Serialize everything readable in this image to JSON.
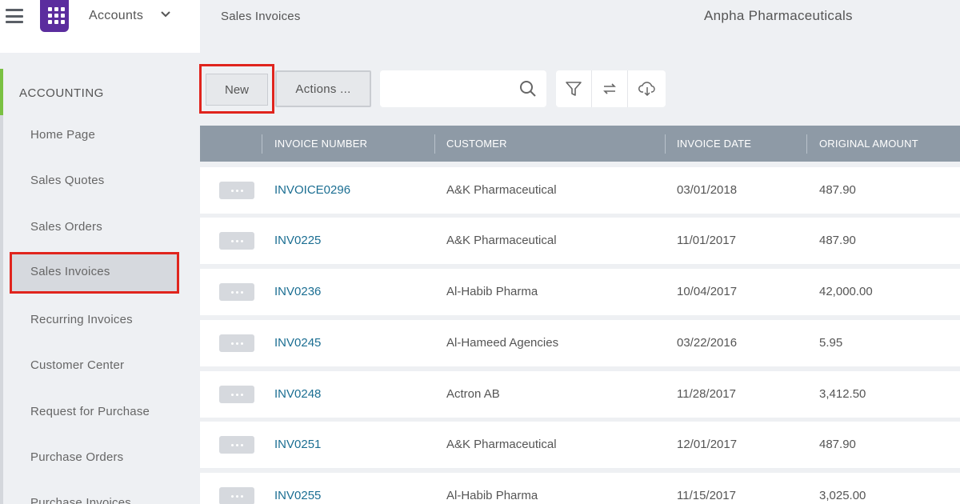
{
  "header": {
    "module": "Accounts",
    "breadcrumb": "Sales Invoices",
    "company": "Anpha Pharmaceuticals"
  },
  "icons": {
    "menu": "hamburger-menu-icon",
    "logo": "app-grid-logo",
    "module_toggle": "chevron-down-icon",
    "search": "search-icon",
    "filter": "filter-icon",
    "refresh": "refresh-icon",
    "download": "cloud-download-icon",
    "row_actions": "more-horizontal-icon"
  },
  "colors": {
    "accent_green": "#7ac142",
    "brand_purple": "#5b2d9e",
    "highlight_red": "#e0241d",
    "table_header": "#8e9aa6",
    "link": "#1b6e92"
  },
  "sidebar": {
    "section": "ACCOUNTING",
    "items": [
      {
        "label": "Home Page",
        "active": false
      },
      {
        "label": "Sales Quotes",
        "active": false
      },
      {
        "label": "Sales Orders",
        "active": false
      },
      {
        "label": "Sales Invoices",
        "active": true
      },
      {
        "label": "Recurring Invoices",
        "active": false
      },
      {
        "label": "Customer Center",
        "active": false
      },
      {
        "label": "Request for Purchase",
        "active": false
      },
      {
        "label": "Purchase Orders",
        "active": false
      },
      {
        "label": "Purchase Invoices",
        "active": false
      }
    ]
  },
  "toolbar": {
    "new_label": "New",
    "actions_label": "Actions ...",
    "search_value": "",
    "search_placeholder": ""
  },
  "table": {
    "columns": [
      "INVOICE NUMBER",
      "CUSTOMER",
      "INVOICE DATE",
      "ORIGINAL AMOUNT"
    ],
    "rows": [
      {
        "invoice_number": "INVOICE0296",
        "customer": "A&K Pharmaceutical",
        "invoice_date": "03/01/2018",
        "original_amount": "487.90"
      },
      {
        "invoice_number": "INV0225",
        "customer": "A&K Pharmaceutical",
        "invoice_date": "11/01/2017",
        "original_amount": "487.90"
      },
      {
        "invoice_number": "INV0236",
        "customer": "Al-Habib Pharma",
        "invoice_date": "10/04/2017",
        "original_amount": "42,000.00"
      },
      {
        "invoice_number": "INV0245",
        "customer": "Al-Hameed Agencies",
        "invoice_date": "03/22/2016",
        "original_amount": "5.95"
      },
      {
        "invoice_number": "INV0248",
        "customer": "Actron AB",
        "invoice_date": "11/28/2017",
        "original_amount": "3,412.50"
      },
      {
        "invoice_number": "INV0251",
        "customer": "A&K Pharmaceutical",
        "invoice_date": "12/01/2017",
        "original_amount": "487.90"
      },
      {
        "invoice_number": "INV0255",
        "customer": "Al-Habib Pharma",
        "invoice_date": "11/15/2017",
        "original_amount": "3,025.00"
      }
    ]
  }
}
